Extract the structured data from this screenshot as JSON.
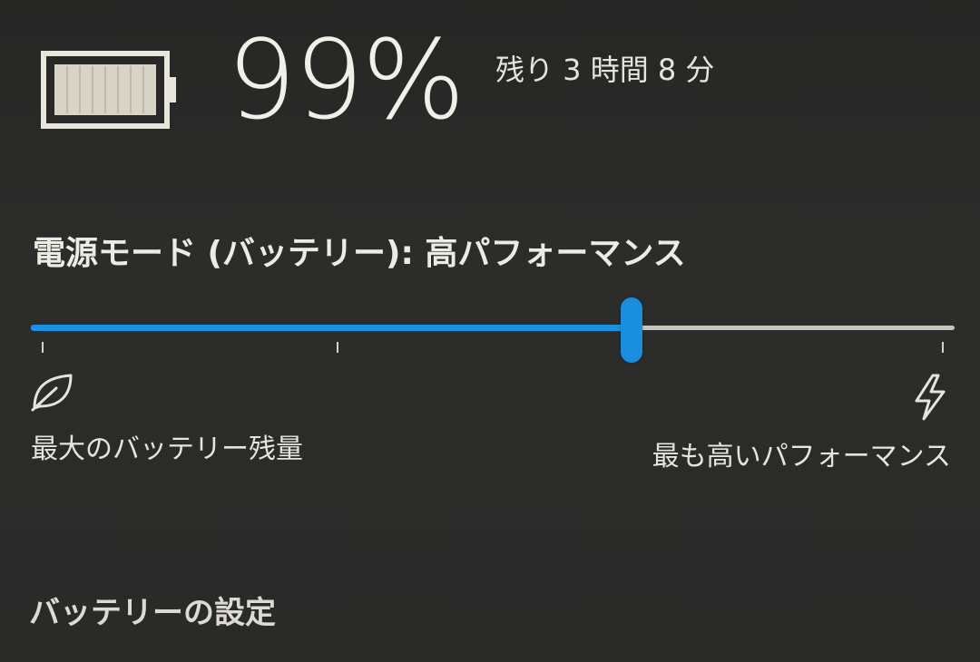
{
  "battery": {
    "percent_text": "99%",
    "percent_value": 99,
    "time_remaining": "残り 3 時間 8 分"
  },
  "power_mode": {
    "label": "電源モード (バッテリー): 高パフォーマンス",
    "slider_value": 0.65,
    "min_label": "最大のバッテリー残量",
    "max_label": "最も高いパフォーマンス",
    "min_icon": "leaf-icon",
    "max_icon": "lightning-bolt-icon"
  },
  "settings_link": "バッテリーの設定",
  "colors": {
    "accent": "#1b92e0",
    "background": "#2b2b2a",
    "text": "#e8e6df"
  }
}
